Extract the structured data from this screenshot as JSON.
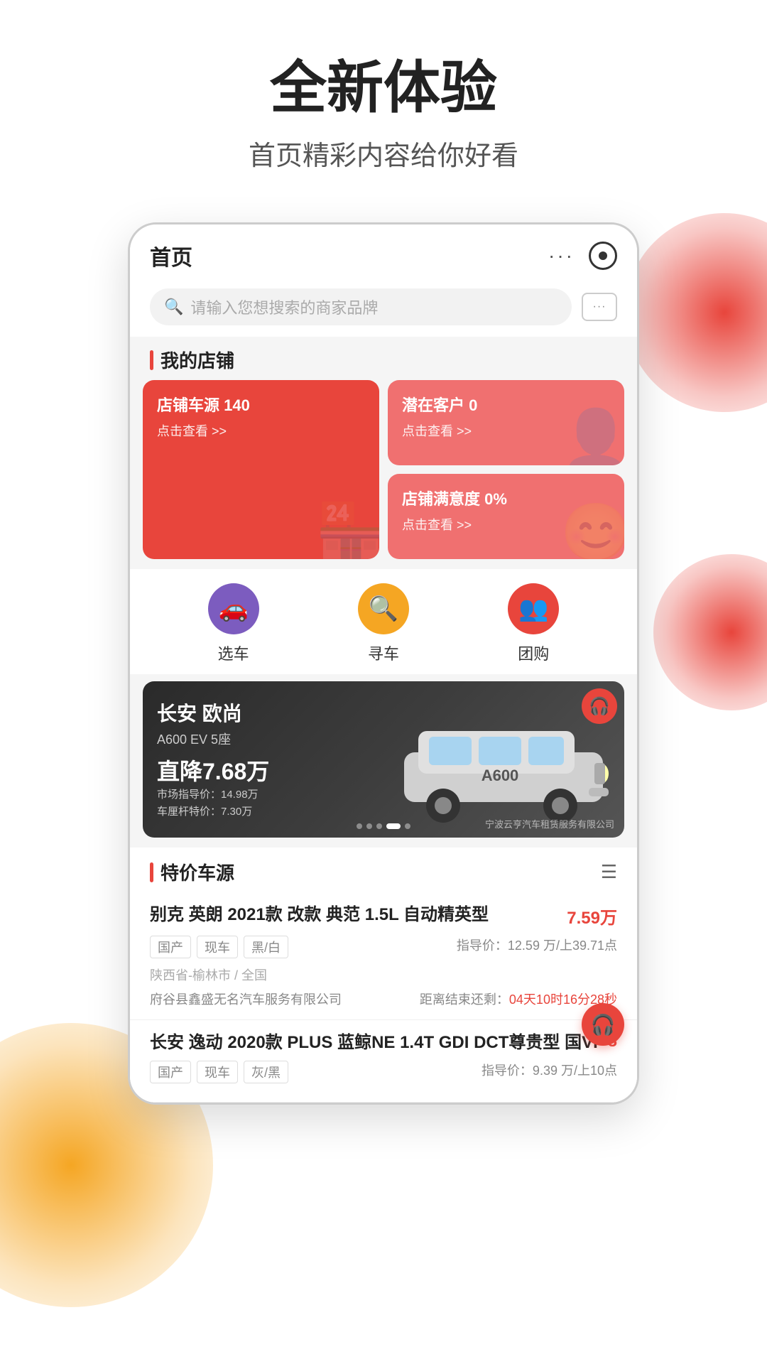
{
  "page": {
    "title": "全新体验",
    "subtitle": "首页精彩内容给你好看"
  },
  "app": {
    "topbar_title": "首页",
    "topbar_dots": "···",
    "search_placeholder": "请输入您想搜索的商家品牌",
    "message_dots": "···"
  },
  "store_section": {
    "title": "我的店铺",
    "cards": [
      {
        "title": "店铺车源 140",
        "action": "点击查看 >>",
        "type": "large",
        "color": "red"
      },
      {
        "title": "潜在客户 0",
        "action": "点击查看 >>",
        "type": "normal",
        "color": "pink"
      },
      {
        "title": "店铺满意度 0%",
        "action": "点击查看 >>",
        "type": "normal",
        "color": "pink"
      }
    ]
  },
  "quick_actions": [
    {
      "label": "选车",
      "color": "purple",
      "icon": "🚗"
    },
    {
      "label": "寻车",
      "color": "yellow",
      "icon": "🔍"
    },
    {
      "label": "团购",
      "color": "red",
      "icon": "👥"
    }
  ],
  "banner": {
    "brand": "长安 欧尚",
    "model": "A600 EV 5座",
    "discount": "直降7.68万",
    "market_price": "市场指导价：14.98万",
    "special_price": "车厘杆特价：7.30万",
    "company": "宁波云亨汽车租赁服务有限公司",
    "dots": [
      false,
      false,
      false,
      true,
      false
    ],
    "headset_icon": "🎧"
  },
  "special_section": {
    "title": "特价车源",
    "cars": [
      {
        "name": "别克 英朗 2021款 改款 典范 1.5L 自动精英型",
        "price": "7.59万",
        "tags": [
          "国产",
          "现车",
          "黑/白"
        ],
        "guide_price": "指导价：12.59 万/上39.71点",
        "location": "陕西省-榆林市 / 全国",
        "dealer": "府谷县鑫盛无名汽车服务有限公司",
        "countdown_label": "距离结束还剩：",
        "countdown": "04天10时16分28秒"
      },
      {
        "name": "长安 逸动 2020款 PLUS 蓝鲸NE 1.4T GDI DCT尊贵型 国VI",
        "price": "8",
        "tags": [
          "国产",
          "现车",
          "灰/黑"
        ],
        "guide_price": "指导价：9.39 万/上10点",
        "location": "",
        "dealer": "",
        "countdown_label": "",
        "countdown": ""
      }
    ]
  },
  "floating": {
    "headset_icon": "🎧"
  }
}
